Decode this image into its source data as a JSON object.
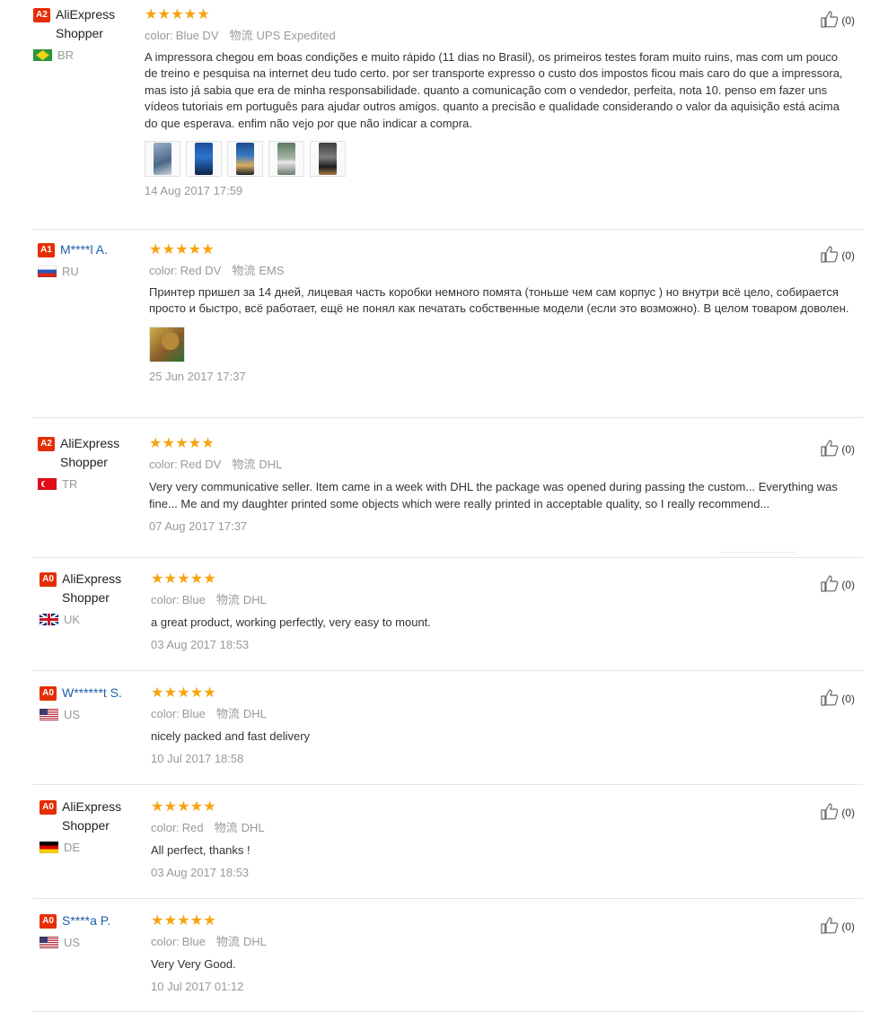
{
  "helpful_label": "(0)",
  "meta_labels": {
    "color": "color:",
    "logistics": "物流"
  },
  "reviews": [
    {
      "user": {
        "badge": "A2",
        "name": "AliExpress Shopper",
        "country": "BR"
      },
      "rating": 5,
      "color": "Blue DV",
      "logistics": "UPS Expedited",
      "text": "A impressora chegou em boas condições e muito rápido (11 dias no Brasil), os primeiros testes foram muito ruins, mas com um pouco de treino e pesquisa na internet deu tudo certo. por ser transporte expresso o custo dos impostos ficou mais caro do que a impressora, mas isto já sabia que era de minha responsabilidade. quanto a comunicação com o vendedor, perfeita, nota 10. penso em fazer uns vídeos tutoriais em português para ajudar outros amigos. quanto a precisão e qualidade considerando o valor da aquisição está acima do que esperava. enfim não vejo por que não indicar a compra.",
      "date": "14 Aug 2017 17:59",
      "helpful": "(0)",
      "photos": 5
    },
    {
      "user": {
        "badge": "A1",
        "name": "M****l A.",
        "country": "RU"
      },
      "rating": 5,
      "color": "Red DV",
      "logistics": "EMS",
      "text": "Принтер пришел за 14 дней, лицевая часть коробки немного помята (тоньше чем сам корпус ) но внутри всё цело, собирается просто и быстро, всё работает, ещё не понял как печатать собственные модели (если это возможно). В целом товаром доволен.",
      "date": "25 Jun 2017 17:37",
      "helpful": "(0)",
      "photos": 1
    },
    {
      "user": {
        "badge": "A2",
        "name": "AliExpress Shopper",
        "country": "TR"
      },
      "rating": 5,
      "color": "Red DV",
      "logistics": "DHL",
      "text": "Very very communicative seller. Item came in a week with DHL the package was opened during passing the custom... Everything was fine... Me and my daughter printed some objects which were really printed in acceptable quality, so I really recommend...",
      "date": "07 Aug 2017 17:37",
      "helpful": "(0)",
      "photos": 0
    },
    {
      "user": {
        "badge": "A0",
        "name": "AliExpress Shopper",
        "country": "UK"
      },
      "rating": 5,
      "color": "Blue",
      "logistics": "DHL",
      "text": "a great product, working perfectly, very easy to mount.",
      "date": "03 Aug 2017 18:53",
      "helpful": "(0)",
      "photos": 0
    },
    {
      "user": {
        "badge": "A0",
        "name": "W******t S.",
        "country": "US"
      },
      "rating": 5,
      "color": "Blue",
      "logistics": "DHL",
      "text": "nicely packed and fast delivery",
      "date": "10 Jul 2017 18:58",
      "helpful": "(0)",
      "photos": 0
    },
    {
      "user": {
        "badge": "A0",
        "name": "AliExpress Shopper",
        "country": "DE"
      },
      "rating": 5,
      "color": "Red",
      "logistics": "DHL",
      "text": "All perfect, thanks !",
      "date": "03 Aug 2017 18:53",
      "helpful": "(0)",
      "photos": 0
    },
    {
      "user": {
        "badge": "A0",
        "name": "S****a P.",
        "country": "US"
      },
      "rating": 5,
      "color": "Blue",
      "logistics": "DHL",
      "text": "Very Very Good.",
      "date": "10 Jul 2017 01:12",
      "helpful": "(0)",
      "photos": 0
    }
  ],
  "colors": {
    "badge": "#e62e04",
    "star": "#f7a30f",
    "meta": "#999999",
    "masked_name": "#1f5ea8"
  }
}
